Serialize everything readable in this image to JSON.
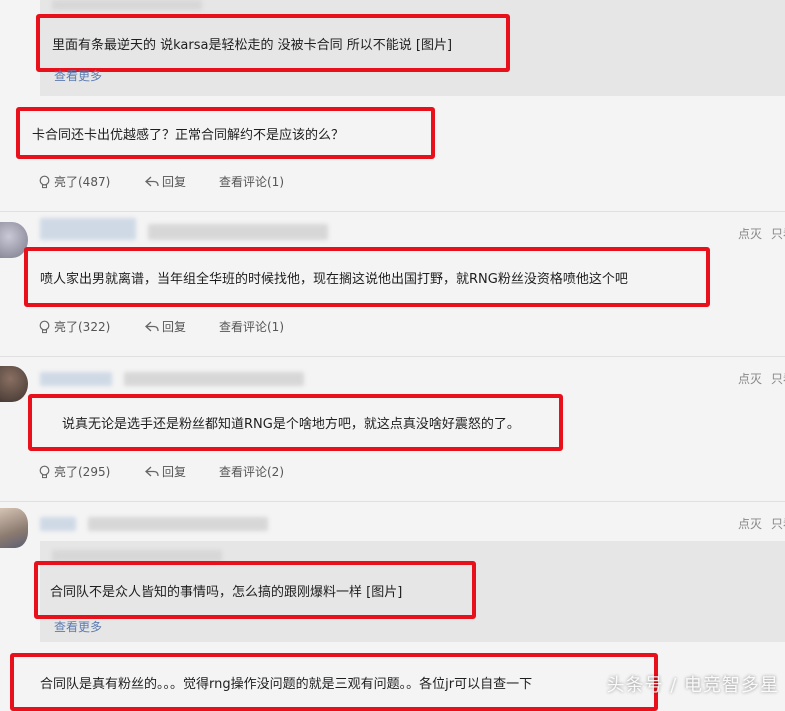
{
  "comments": [
    {
      "quote_text": "里面有条最逆天的 说karsa是轻松走的 没被卡合同 所以不能说 [图片]",
      "quote_more": "查看更多",
      "text": "卡合同还卡出优越感了？正常合同解约不是应该的么？",
      "like_label": "亮了(487)",
      "reply_label": "回复",
      "view_label": "查看评论(1)"
    },
    {
      "text": "喷人家出男就离谱，当年组全华班的时候找他，现在搁这说他出国打野，就RNG粉丝没资格喷他这个吧",
      "like_label": "亮了(322)",
      "reply_label": "回复",
      "view_label": "查看评论(1)",
      "dislike_label": "点灭",
      "only_label": "只看"
    },
    {
      "text": "说真无论是选手还是粉丝都知道RNG是个啥地方吧，就这点真没啥好震怒的了。",
      "like_label": "亮了(295)",
      "reply_label": "回复",
      "view_label": "查看评论(2)",
      "dislike_label": "点灭",
      "only_label": "只看"
    },
    {
      "quote_text": "合同队不是众人皆知的事情吗，怎么搞的跟刚爆料一样 [图片]",
      "quote_more": "查看更多",
      "text": "合同队是真有粉丝的。。。觉得rng操作没问题的就是三观有问题。。各位jr可以自查一下",
      "dislike_label": "点灭",
      "only_label": "只看"
    }
  ],
  "watermark": "头条号 / 电竞智多星",
  "colors": {
    "highlight_border": "#e8101a",
    "link": "#5c7bb0",
    "quote_bg": "#e6e6e6",
    "page_bg": "#f4f4f4"
  }
}
